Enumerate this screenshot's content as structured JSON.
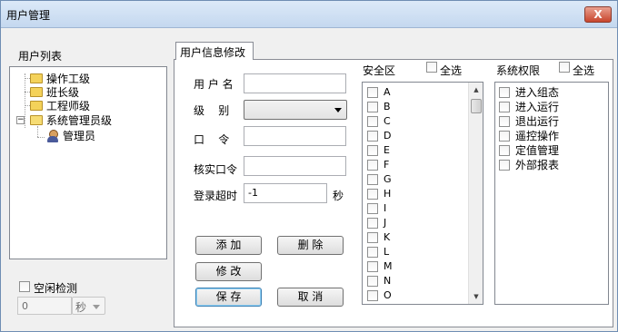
{
  "window": {
    "title": "用户管理",
    "close_glyph": "X"
  },
  "user_list": {
    "label": "用户列表",
    "tree": [
      {
        "label": "操作工级",
        "icon": "folder-icon"
      },
      {
        "label": "班长级",
        "icon": "folder-icon"
      },
      {
        "label": "工程师级",
        "icon": "folder-icon"
      },
      {
        "label": "系统管理员级",
        "icon": "folder-open-icon",
        "expanded": true
      },
      {
        "label": "管理员",
        "icon": "user-icon"
      }
    ],
    "expander_glyph": "−"
  },
  "idle_check": {
    "label": "空闲检测",
    "value": "0",
    "unit": "秒",
    "checked": false
  },
  "tab": {
    "label": "用户信息修改"
  },
  "form": {
    "username_label": "用 户 名",
    "username_value": "",
    "level_label": "级    别",
    "level_value": "",
    "password_label": "口    令",
    "password_value": "",
    "confirm_label": "核实口令",
    "confirm_value": "",
    "timeout_label": "登录超时",
    "timeout_value": "-1",
    "timeout_unit": "秒"
  },
  "buttons": {
    "add": "添 加",
    "delete": "删 除",
    "modify": "修 改",
    "save": "保 存",
    "cancel": "取 消"
  },
  "security_zone": {
    "label": "安全区",
    "select_all": "全选",
    "items": [
      "A",
      "B",
      "C",
      "D",
      "E",
      "F",
      "G",
      "H",
      "I",
      "J",
      "K",
      "L",
      "M",
      "N",
      "O"
    ]
  },
  "permissions": {
    "label": "系统权限",
    "select_all": "全选",
    "items": [
      "进入组态",
      "进入运行",
      "退出运行",
      "遥控操作",
      "定值管理",
      "外部报表"
    ]
  },
  "scroll": {
    "up_glyph": "▲",
    "down_glyph": "▼"
  }
}
